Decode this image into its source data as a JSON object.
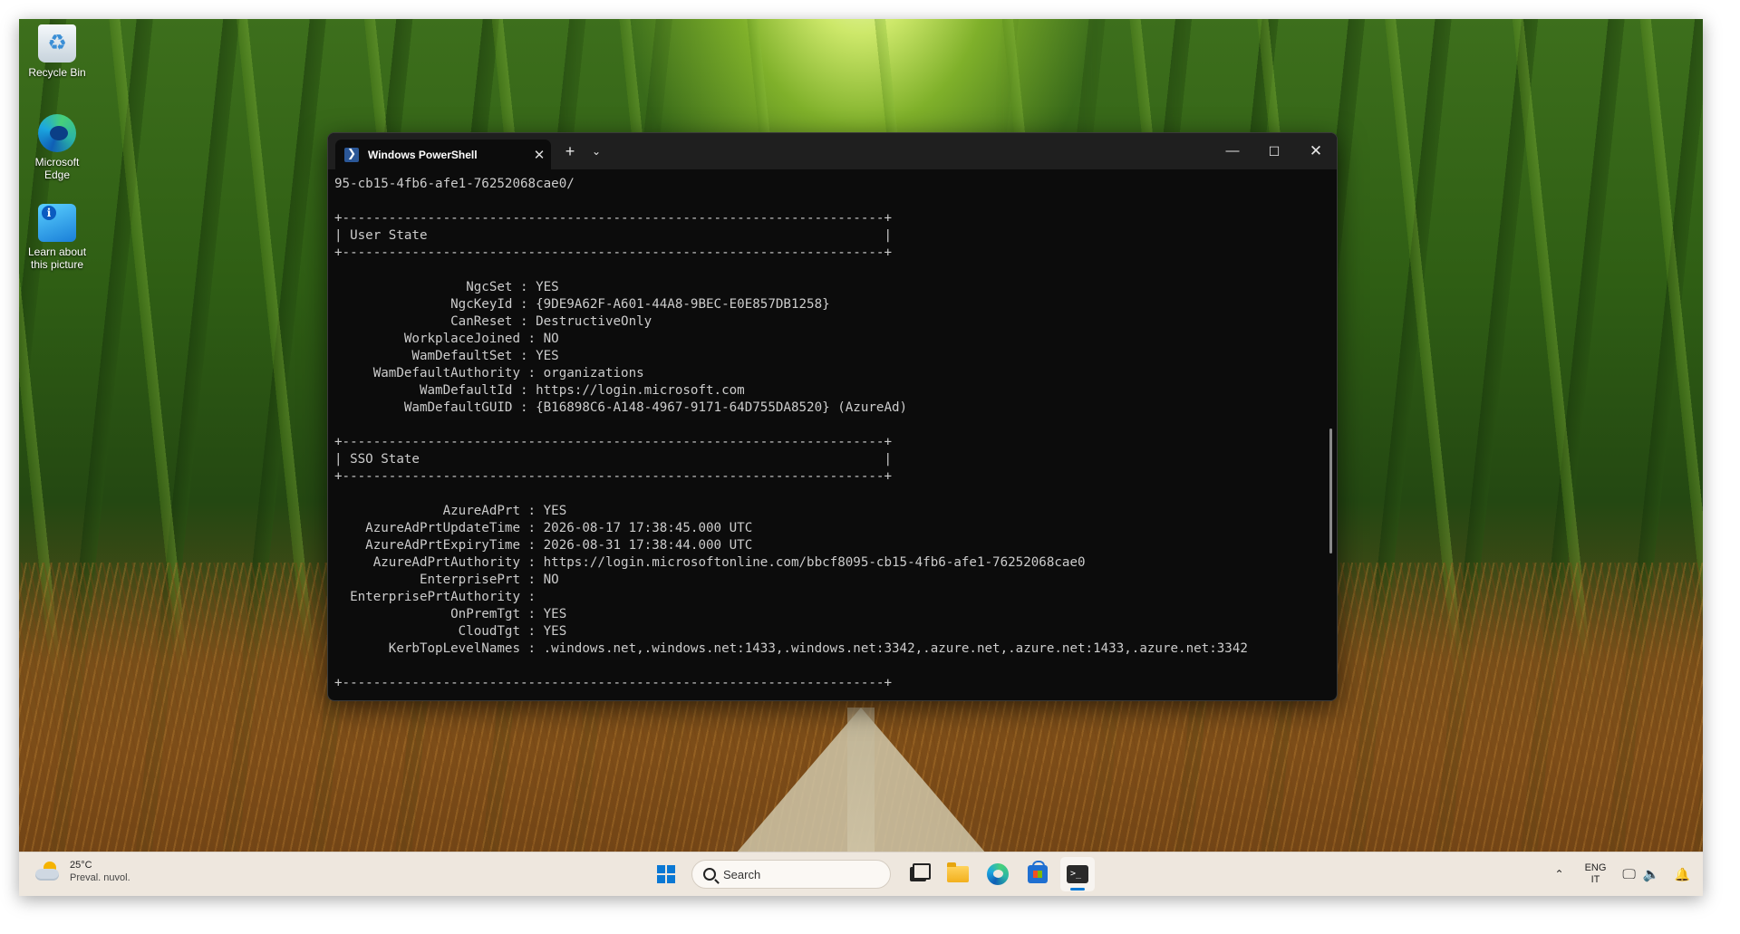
{
  "desktop": {
    "icons": [
      {
        "label": "Recycle Bin"
      },
      {
        "label": "Microsoft Edge"
      },
      {
        "label": "Learn about this picture"
      }
    ]
  },
  "terminal": {
    "tab_title": "Windows PowerShell",
    "lines": [
      "95-cb15-4fb6-afe1-76252068cae0/",
      "",
      "+----------------------------------------------------------------------+",
      "| User State                                                           |",
      "+----------------------------------------------------------------------+",
      "",
      "                 NgcSet : YES",
      "               NgcKeyId : {9DE9A62F-A601-44A8-9BEC-E0E857DB1258}",
      "               CanReset : DestructiveOnly",
      "         WorkplaceJoined : NO",
      "          WamDefaultSet : YES",
      "     WamDefaultAuthority : organizations",
      "           WamDefaultId : https://login.microsoft.com",
      "         WamDefaultGUID : {B16898C6-A148-4967-9171-64D755DA8520} (AzureAd)",
      "",
      "+----------------------------------------------------------------------+",
      "| SSO State                                                            |",
      "+----------------------------------------------------------------------+",
      "",
      "              AzureAdPrt : YES",
      "    AzureAdPrtUpdateTime : 2026-08-17 17:38:45.000 UTC",
      "    AzureAdPrtExpiryTime : 2026-08-31 17:38:44.000 UTC",
      "     AzureAdPrtAuthority : https://login.microsoftonline.com/bbcf8095-cb15-4fb6-afe1-76252068cae0",
      "           EnterprisePrt : NO",
      "  EnterprisePrtAuthority :",
      "               OnPremTgt : YES",
      "                CloudTgt : YES",
      "       KerbTopLevelNames : .windows.net,.windows.net:1433,.windows.net:3342,.azure.net,.azure.net:1433,.azure.net:3342",
      "",
      "+----------------------------------------------------------------------+"
    ]
  },
  "taskbar": {
    "weather": {
      "temp": "25°C",
      "condition": "Preval. nuvol."
    },
    "search_placeholder": "Search",
    "lang_primary": "ENG",
    "lang_secondary": "IT",
    "icons": [
      "windows-start-icon",
      "search-icon",
      "task-view-icon",
      "file-explorer-icon",
      "edge-icon",
      "store-icon",
      "terminal-icon",
      "chevron-up-icon",
      "network-icon",
      "volume-icon",
      "notification-bell-icon"
    ],
    "accent": "#0a78d4"
  }
}
